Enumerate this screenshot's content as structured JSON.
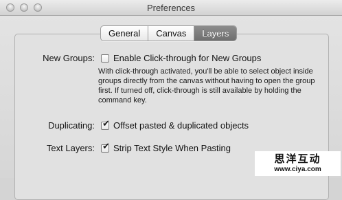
{
  "window": {
    "title": "Preferences"
  },
  "tabs": [
    {
      "label": "General",
      "active": false
    },
    {
      "label": "Canvas",
      "active": false
    },
    {
      "label": "Layers",
      "active": true
    }
  ],
  "new_groups": {
    "label": "New Groups:",
    "option": "Enable Click-through for New Groups",
    "checked": false,
    "description": "With click-through activated, you'll be able to select object inside groups directly from the canvas without having to open the group first. If turned off, click-through is still available by holding the command key."
  },
  "duplicating": {
    "label": "Duplicating:",
    "option": "Offset pasted & duplicated objects",
    "checked": true
  },
  "text_layers": {
    "label": "Text Layers:",
    "option": "Strip Text Style When Pasting",
    "checked": true
  },
  "watermark": {
    "title": "思洋互动",
    "url": "www.ciya.com"
  }
}
